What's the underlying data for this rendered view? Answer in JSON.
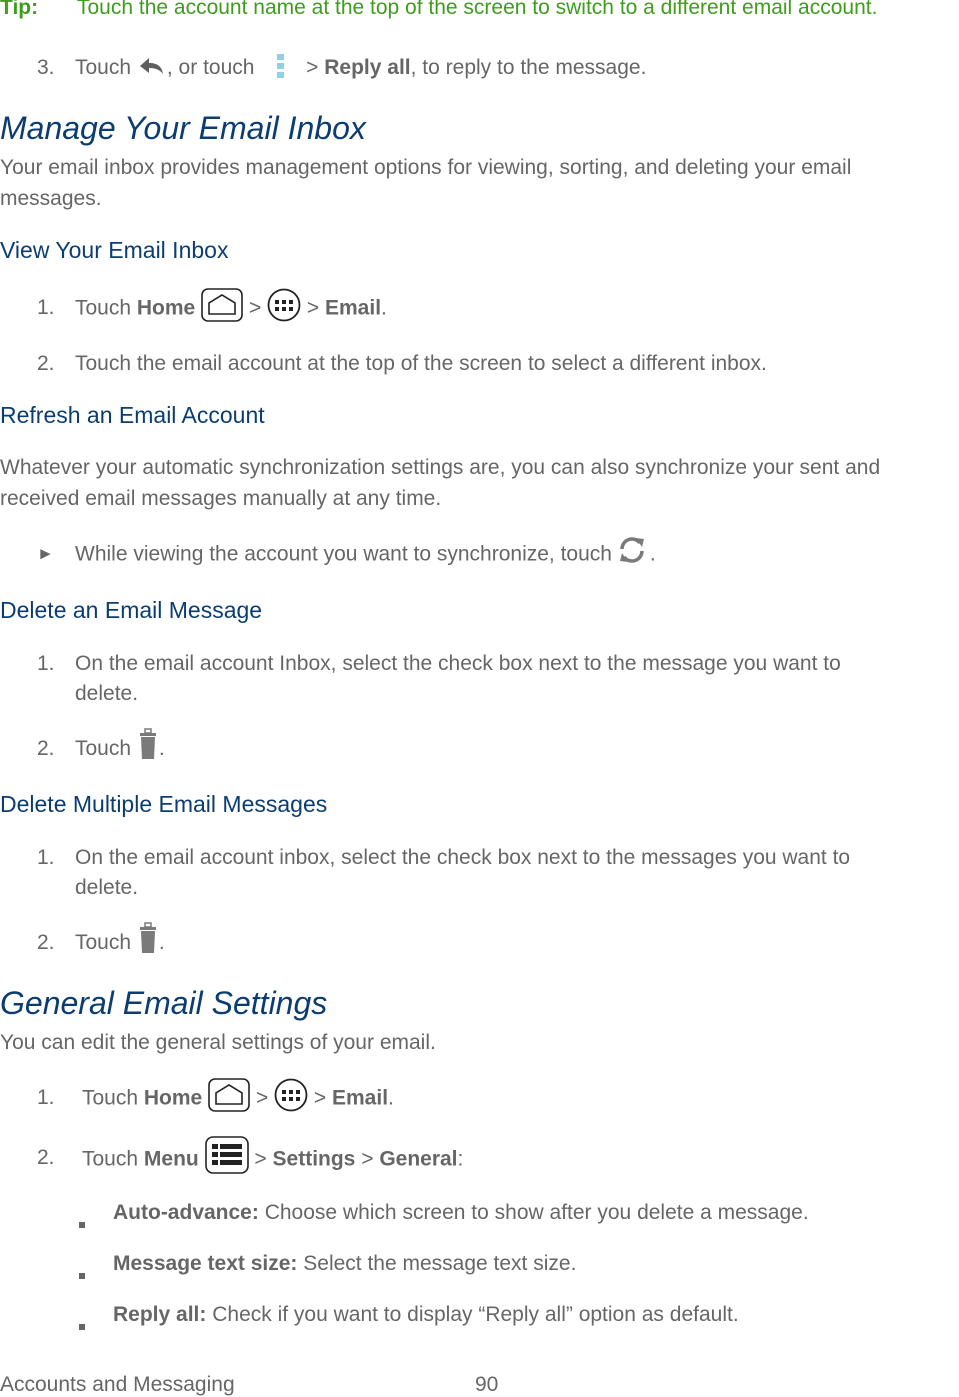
{
  "tip": {
    "label": "Tip:",
    "text": "Touch the account name at the top of the screen to switch to a different email account."
  },
  "step3": {
    "num": "3.",
    "pre": "Touch",
    "mid": ", or touch",
    "sep": ">",
    "bold": "Reply all",
    "post": ", to reply to the message."
  },
  "manage": {
    "title": "Manage Your Email Inbox",
    "desc_line1": "Your email inbox provides management options for viewing, sorting, and deleting your email",
    "desc_line2": "messages."
  },
  "view_inbox": {
    "title": "View Your Email Inbox",
    "steps": [
      {
        "num": "1.",
        "pre": "Touch",
        "bold1": "Home",
        "sep": ">",
        "bold2": "Email",
        "end": "."
      },
      {
        "num": "2.",
        "text": "Touch the email account at the top of the screen to select a different inbox."
      }
    ]
  },
  "refresh": {
    "title": "Refresh an Email Account",
    "desc_line1": "Whatever your automatic synchronization settings are, you can also synchronize your sent and",
    "desc_line2": "received email messages manually at any time.",
    "bullet_marker": "►",
    "bullet_text": "While viewing the account you want to synchronize, touch",
    "bullet_end": "."
  },
  "delete_one": {
    "title": "Delete an Email Message",
    "steps": [
      {
        "num": "1.",
        "line1": "On the email account Inbox, select the check box next to the message you want to",
        "line2": "delete."
      },
      {
        "num": "2.",
        "pre": "Touch",
        "end": "."
      }
    ]
  },
  "delete_multi": {
    "title": "Delete Multiple Email Messages",
    "steps": [
      {
        "num": "1.",
        "line1": "On the email account inbox, select the check box next to the messages you want to",
        "line2": "delete."
      },
      {
        "num": "2.",
        "pre": "Touch",
        "end": "."
      }
    ]
  },
  "general": {
    "title": "General Email Settings",
    "desc": "You can edit the general settings of your email.",
    "steps": [
      {
        "num": "1.",
        "pre": "Touch",
        "bold1": "Home",
        "sep": ">",
        "bold2": "Email",
        "end": "."
      },
      {
        "num": "2.",
        "pre": "Touch",
        "bold1": "Menu",
        "sep": ">",
        "bold2": "Settings",
        "bold3": "General",
        "end": ":"
      }
    ],
    "options": [
      {
        "label": "Auto-advance:",
        "text": "Choose which screen to show after you delete a message."
      },
      {
        "label": "Message text size:",
        "text": "Select the message text size."
      },
      {
        "label": "Reply all:",
        "text": "Check if you want to display “Reply all” option as default."
      }
    ]
  },
  "footer": {
    "section": "Accounts and Messaging",
    "page": "90"
  },
  "icons": {
    "reply": "reply-icon",
    "overflow": "overflow-menu-icon",
    "home": "home-icon",
    "apps": "apps-icon",
    "refresh": "refresh-icon",
    "trash": "trash-icon",
    "menu": "menu-icon"
  },
  "colors": {
    "tip_green": "#3f9c1f",
    "heading_blue": "#0c3d72",
    "body_gray": "#666666",
    "overflow_blue": "#8fd0ea"
  }
}
